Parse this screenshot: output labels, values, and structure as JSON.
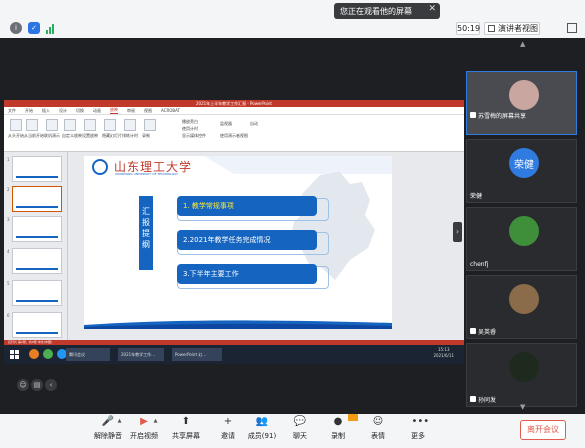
{
  "top": {
    "share_notice": "您正在观看他的屏幕",
    "close_glyph": "✕",
    "timer": "50:19",
    "view_button": "演讲者视图"
  },
  "ppt": {
    "title": "2021年上半年教学工作汇报 · PowerPoint",
    "menu": [
      "文件",
      "开始",
      "插入",
      "设计",
      "切换",
      "动画",
      "放映",
      "审阅",
      "视图",
      "ACROBAT"
    ],
    "active_menu_index": 6,
    "ribbon_labels": [
      "从头开始",
      "从当前开始",
      "联机演示",
      "自定义放映",
      "设置放映",
      "隐藏幻灯片",
      "排练计时",
      "录制",
      "播放旁白",
      "使用计时",
      "显示媒体控件",
      "监视器",
      "自动",
      "使用演示者视图"
    ],
    "status": "幻灯片 第2张，共9张   中文(中国)",
    "slide": {
      "logo_text": "山东理工大学",
      "logo_sub": "SHANDONG UNIVERSITY OF TECHNOLOGY",
      "side_title": "汇报提纲",
      "agenda": [
        "1. 教学常规事项",
        "2.2021年教学任务完成情况",
        "3.下半年主要工作"
      ],
      "highlight_index": 0
    }
  },
  "taskbar": {
    "tasks": [
      "腾讯会议",
      "2021年教学工作...",
      "PowerPoint 幻..."
    ],
    "time": "15:13",
    "date": "2021/6/11"
  },
  "participants": [
    {
      "name": "苏雪梅的屏幕共享",
      "avatar_color": "#c9a7a0"
    },
    {
      "name": "荣健",
      "avatar_text": "荣健"
    },
    {
      "name": "chenfj",
      "avatar_color": "#3f8f3a"
    },
    {
      "name": "吴英睿",
      "avatar_color": "#8a6b4a"
    },
    {
      "name": "孙同发",
      "avatar_color": "#1f2a1f"
    }
  ],
  "bottom": {
    "buttons": [
      "解除静音",
      "开启视频",
      "共享屏幕",
      "邀请",
      "成员(91)",
      "聊天",
      "录制",
      "表情",
      "更多"
    ],
    "leave": "离开会议"
  },
  "colors": {
    "accent_blue": "#1565c0",
    "ppt_red": "#c0392b",
    "leave_red": "#e15b4e",
    "highlight_yellow": "#ffeb3b"
  },
  "icons": {
    "bottom": [
      "mic-muted-icon",
      "video-off-icon",
      "share-screen-icon",
      "invite-icon",
      "members-icon",
      "chat-icon",
      "record-icon",
      "emoji-icon",
      "more-icon"
    ]
  }
}
